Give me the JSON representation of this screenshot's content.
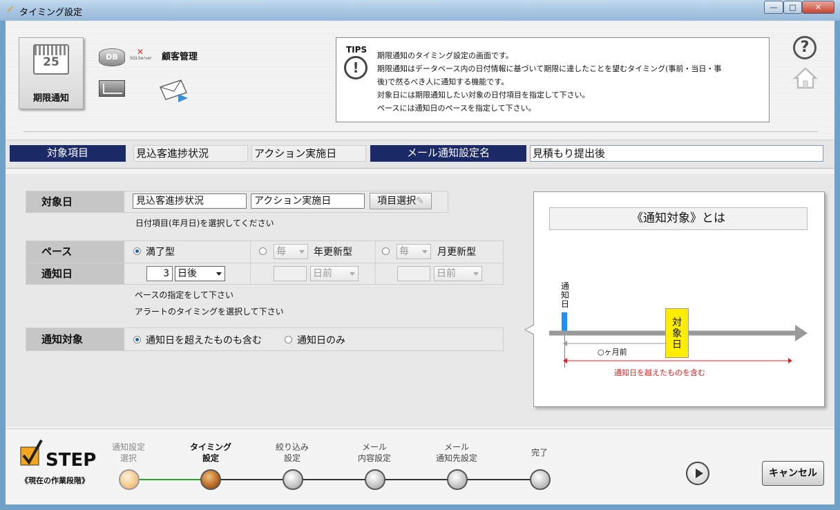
{
  "window": {
    "title": "タイミング設定",
    "min_glyph": "—",
    "max_glyph": "□",
    "close_glyph": "✕"
  },
  "header": {
    "calendar_number": "25",
    "calendar_label": "期限通知",
    "db_label": "DB",
    "customer_label": "顧客管理",
    "brand_text": "SQLServer"
  },
  "tips": {
    "label": "TIPS",
    "icon_glyph": "!",
    "lines": [
      "期限通知のタイミング設定の画面です。",
      "期限通知はデータベース内の日付情報に基づいて期限に達したことを望むタイミング(事前・当日・事",
      "後)で然るべき人に通知する機能です。",
      "対象日には期限通知したい対象の日付項目を指定して下さい。",
      "ペースには通知日のペースを指定して下さい。"
    ]
  },
  "help_glyph": "?",
  "summary": {
    "target_item_label": "対象項目",
    "field1": "見込客進捗状況",
    "field2": "アクション実施日",
    "mail_setting_label": "メール通知設定名",
    "mail_setting_value": "見積もり提出後"
  },
  "form": {
    "target_date": {
      "label": "対象日",
      "field1": "見込客進捗状況",
      "field2": "アクション実施日",
      "select_button": "項目選択",
      "hint": "日付項目(年月日)を選択してください"
    },
    "pace": {
      "label": "ペース",
      "option1": "満了型",
      "option2_select": "毎",
      "option2": "年更新型",
      "option3_select": "毎",
      "option3": "月更新型",
      "selected": "満了型"
    },
    "notify_day": {
      "label": "通知日",
      "value": "3",
      "unit": "日後",
      "unit2": "日前",
      "unit3": "日前"
    },
    "hints": [
      "ペースの指定をして下さい",
      "アラートのタイミングを選択して下さい"
    ],
    "notify_target": {
      "label": "通知対象",
      "option1": "通知日を超えたものも含む",
      "option2": "通知日のみ",
      "selected": "通知日を超えたものも含む"
    }
  },
  "diagram": {
    "title": "《通知対象》とは",
    "notify_day_label": "通知日",
    "target_day_label": "対象日",
    "months_before": "○ヶ月前",
    "include_label": "通知日を越えたものを含む",
    "colors": {
      "notify_marker": "#1e90ff",
      "target_box": "#ffee00",
      "include_arrow": "#e02020"
    }
  },
  "steps": {
    "title": "STEP",
    "subtitle": "《現在の作業段階》",
    "items": [
      {
        "label1": "通知設定",
        "label2": "選択",
        "state": "done"
      },
      {
        "label1": "タイミング",
        "label2": "設定",
        "state": "current"
      },
      {
        "label1": "絞り込み",
        "label2": "設定",
        "state": "todo"
      },
      {
        "label1": "メール",
        "label2": "内容設定",
        "state": "todo"
      },
      {
        "label1": "メール",
        "label2": "通知先設定",
        "state": "todo"
      },
      {
        "label1": "完了",
        "label2": "",
        "state": "todo"
      }
    ],
    "cancel_label": "キャンセル"
  }
}
